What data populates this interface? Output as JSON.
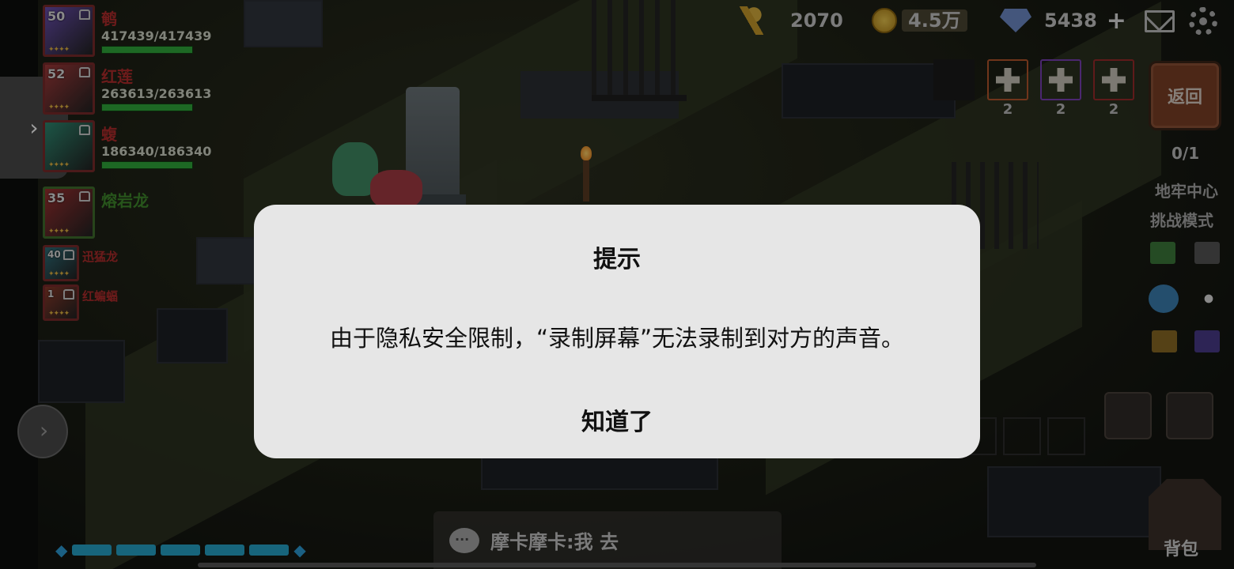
{
  "party": [
    {
      "level": "50",
      "name": "鹌",
      "hp": "417439/417439",
      "hp_fraction": 1.0,
      "color": "#6a4fb0"
    },
    {
      "level": "52",
      "name": "红莲",
      "hp": "263613/263613",
      "hp_fraction": 1.0,
      "color": "#a23a3a"
    },
    {
      "level": "",
      "name": "蝮",
      "hp": "186340/186340",
      "hp_fraction": 1.0,
      "color": "#2f8a72"
    },
    {
      "level": "35",
      "name": "熔岩龙",
      "hp": "",
      "color": "#9c3030"
    },
    {
      "level": "40",
      "name": "迅猛龙",
      "hp": "",
      "color": "#2f6f7a"
    },
    {
      "level": "1",
      "name": "红蝙蝠",
      "hp": "",
      "color": "#8a3a2a"
    }
  ],
  "party_name_colors": {
    "primary": "#b12c2c",
    "secondary": "#3f8a2c"
  },
  "resources": {
    "wheat": "2070",
    "coins": "4.5万",
    "gems": "5438"
  },
  "slots": [
    {
      "count": "2",
      "border": "#b5562c"
    },
    {
      "count": "2",
      "border": "#7a3fb5"
    },
    {
      "count": "2",
      "border": "#9a2a2a"
    }
  ],
  "back_button": "返回",
  "progress": "0/1",
  "side_labels": {
    "dungeon": "地牢中心",
    "challenge": "挑战模式"
  },
  "bag_label": "背包",
  "chat": {
    "message": "摩卡摩卡:我 去"
  },
  "dialog": {
    "title": "提示",
    "message": "由于隐私安全限制，“录制屏幕”无法录制到对方的声音。",
    "button": "知道了"
  }
}
